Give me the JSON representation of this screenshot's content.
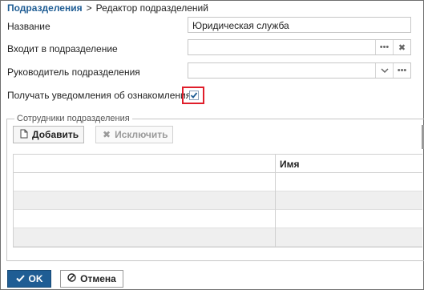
{
  "breadcrumb": {
    "root": "Подразделения",
    "separator": ">",
    "current": "Редактор подразделений"
  },
  "form": {
    "name_label": "Название",
    "name_value": "Юридическая служба",
    "parent_label": "Входит в подразделение",
    "parent_value": "",
    "manager_label": "Руководитель подразделения",
    "manager_value": "",
    "notify_label": "Получать уведомления об ознакомлениях",
    "notify_checked": true
  },
  "employees": {
    "legend": "Сотрудники подразделения",
    "add_label": "Добавить",
    "exclude_label": "Исключить",
    "columns": [
      "",
      "Имя"
    ],
    "rows": [
      [
        "",
        ""
      ],
      [
        "",
        ""
      ],
      [
        "",
        ""
      ],
      [
        "",
        ""
      ]
    ]
  },
  "footer": {
    "ok_label": "OK",
    "cancel_label": "Отмена"
  },
  "colors": {
    "accent": "#1f5d94",
    "highlight": "#e01e2b"
  },
  "icons": {
    "ellipsis": "ellipsis-icon",
    "clear": "close-icon",
    "dropdown": "chevron-down-icon",
    "check": "checkmark-icon",
    "add": "document-icon",
    "exclude": "close-icon",
    "ok": "checkmark-icon",
    "cancel": "ban-icon"
  }
}
